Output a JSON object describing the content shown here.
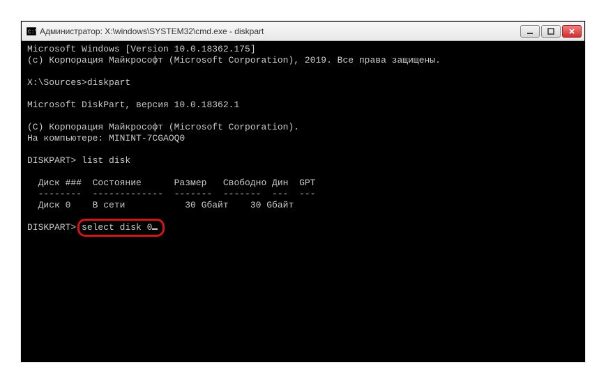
{
  "titlebar": {
    "title": "Администратор: X:\\windows\\SYSTEM32\\cmd.exe - diskpart"
  },
  "terminal": {
    "line1": "Microsoft Windows [Version 10.0.18362.175]",
    "line2": "(c) Корпорация Майкрософт (Microsoft Corporation), 2019. Все права защищены.",
    "prompt1_path": "X:\\Sources>",
    "prompt1_cmd": "diskpart",
    "dp_version": "Microsoft DiskPart, версия 10.0.18362.1",
    "dp_copy": "(C) Корпорация Майкрософт (Microsoft Corporation).",
    "dp_host": "На компьютере: MININT-7CGAOQ0",
    "prompt2_label": "DISKPART>",
    "prompt2_cmd": " list disk",
    "table_header": "  Диск ###  Состояние      Размер   Свободно Дин  GPT",
    "table_sep": "  --------  -------------  -------  -------  ---  ---",
    "table_row1": "  Диск 0    В сети           30 Gбайт    30 Gбайт",
    "prompt3_label": "DISKPART>",
    "prompt3_cmd": "select disk 0"
  }
}
